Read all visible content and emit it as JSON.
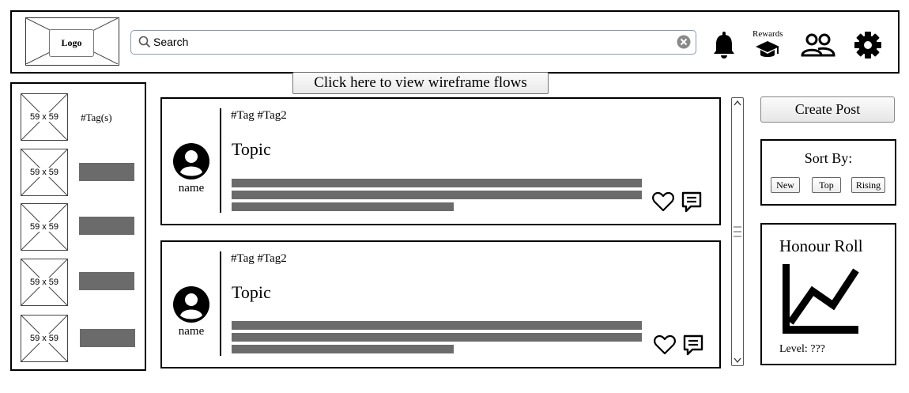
{
  "header": {
    "logo_label": "Logo",
    "search": {
      "placeholder": "Search",
      "value": ""
    },
    "icons": [
      "bell-icon",
      "rewards-icon",
      "friends-icon",
      "settings-icon"
    ],
    "rewards_label": "Rewards"
  },
  "flows_button": {
    "label": "Click here to view wireframe flows"
  },
  "sidebar": {
    "placeholder_label": "59 x 59",
    "items": [
      {
        "thumb": "59 x 59",
        "label": "#Tag(s)"
      },
      {
        "thumb": "59 x 59",
        "label": ""
      },
      {
        "thumb": "59 x 59",
        "label": ""
      },
      {
        "thumb": "59 x 59",
        "label": ""
      },
      {
        "thumb": "59 x 59",
        "label": ""
      }
    ]
  },
  "posts": [
    {
      "tags": "#Tag #Tag2",
      "topic": "Topic",
      "author": "name"
    },
    {
      "tags": "#Tag #Tag2",
      "topic": "Topic",
      "author": "name"
    }
  ],
  "right": {
    "create_post_label": "Create Post",
    "sort": {
      "title": "Sort By:",
      "options": [
        "New",
        "Top",
        "Rising"
      ]
    },
    "honour": {
      "title": "Honour Roll",
      "level_text": "Level: ???"
    }
  }
}
